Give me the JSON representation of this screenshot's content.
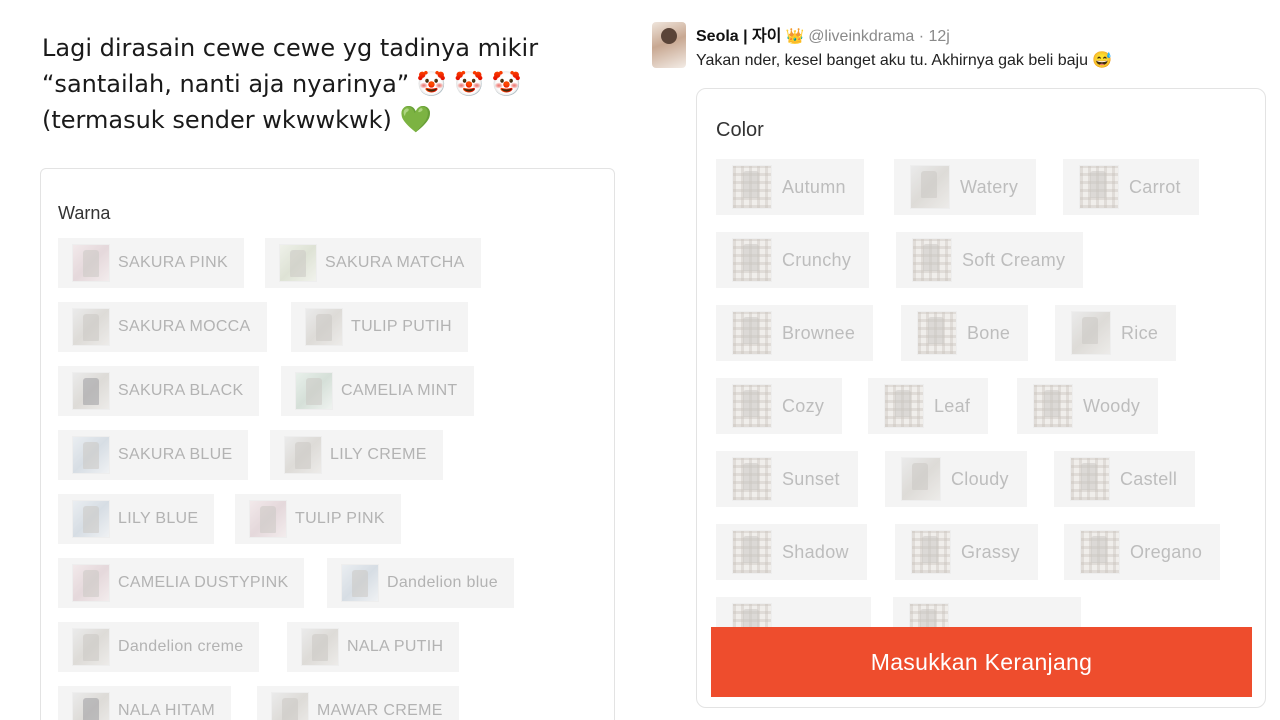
{
  "left_post": {
    "caption_lines": [
      "Lagi dirasain cewe cewe yg tadinya mikir",
      "“santailah, nanti aja nyarinya”",
      "(termasuk sender wkwwkwk)"
    ],
    "caption_emoji_line2": "🤡 🤡 🤡",
    "caption_emoji_line3": "💚",
    "variant_label": "Warna",
    "variants": [
      "SAKURA PINK",
      "SAKURA MATCHA",
      "SAKURA MOCCA",
      "TULIP PUTIH",
      "SAKURA BLACK",
      "CAMELIA MINT",
      "SAKURA BLUE",
      "LILY CREME",
      "LILY BLUE",
      "TULIP PINK",
      "CAMELIA DUSTYPINK",
      "Dandelion blue",
      "Dandelion creme",
      "NALA PUTIH",
      "NALA HITAM",
      "MAWAR CREME"
    ]
  },
  "right_post": {
    "author_name": "Seola | 자이",
    "author_badge": "👑",
    "handle": "@liveinkdrama",
    "separator": "·",
    "time": "12j",
    "text": "Yakan nder, kesel banget aku tu. Akhirnya gak beli baju 😅",
    "variant_label": "Color",
    "variants": [
      "Autumn",
      "Watery",
      "Carrot",
      "Crunchy",
      "Soft Creamy",
      "Brownee",
      "Bone",
      "Rice",
      "Cozy",
      "Leaf",
      "Woody",
      "Sunset",
      "Cloudy",
      "Castell",
      "Shadow",
      "Grassy",
      "Oregano",
      "",
      ""
    ],
    "cart_button": "Masukkan Keranjang"
  },
  "colors": {
    "cart_button": "#ee4d2d",
    "chip_bg": "#f4f4f4",
    "disabled_text": "#b3b3b3",
    "heart": "#3aa655"
  }
}
